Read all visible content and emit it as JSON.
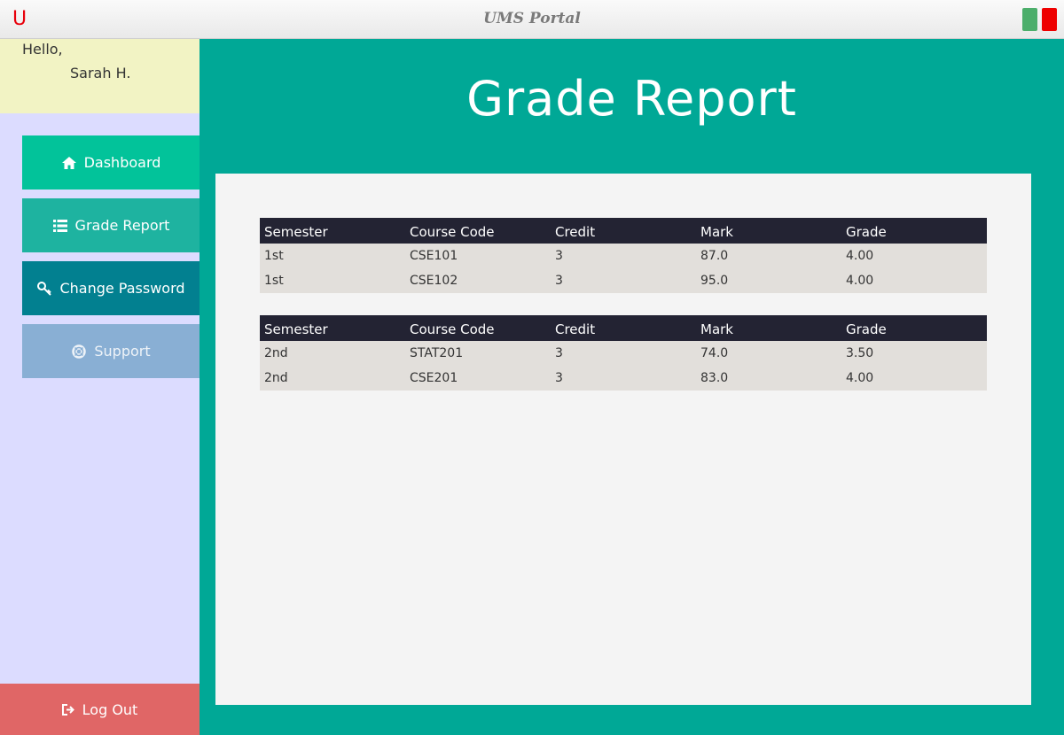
{
  "window": {
    "logo": "U",
    "title": "UMS Portal"
  },
  "sidebar": {
    "greeting": "Hello,",
    "username": "Sarah H.",
    "items": [
      {
        "label": "Dashboard",
        "icon": "home-icon"
      },
      {
        "label": "Grade Report",
        "icon": "list-icon"
      },
      {
        "label": "Change Password",
        "icon": "key-icon"
      },
      {
        "label": "Support",
        "icon": "lifebuoy-icon"
      }
    ],
    "logout": {
      "label": "Log Out",
      "icon": "sign-out-icon"
    }
  },
  "main": {
    "title": "Grade Report",
    "columns": [
      "Semester",
      "Course Code",
      "Credit",
      "Mark",
      "Grade"
    ],
    "tables": [
      {
        "rows": [
          [
            "1st",
            "CSE101",
            "3",
            "87.0",
            "4.00"
          ],
          [
            "1st",
            "CSE102",
            "3",
            "95.0",
            "4.00"
          ]
        ]
      },
      {
        "rows": [
          [
            "2nd",
            "STAT201",
            "3",
            "74.0",
            "3.50"
          ],
          [
            "2nd",
            "CSE201",
            "3",
            "83.0",
            "4.00"
          ]
        ]
      }
    ]
  },
  "colors": {
    "accent": "#00a896",
    "dashboard": "#02c39a",
    "grade_report": "#1eb3a0",
    "change_password": "#028090",
    "support": "#89afd4",
    "logout": "#e06666",
    "table_header": "#232333",
    "table_row": "#e2dfdb"
  }
}
